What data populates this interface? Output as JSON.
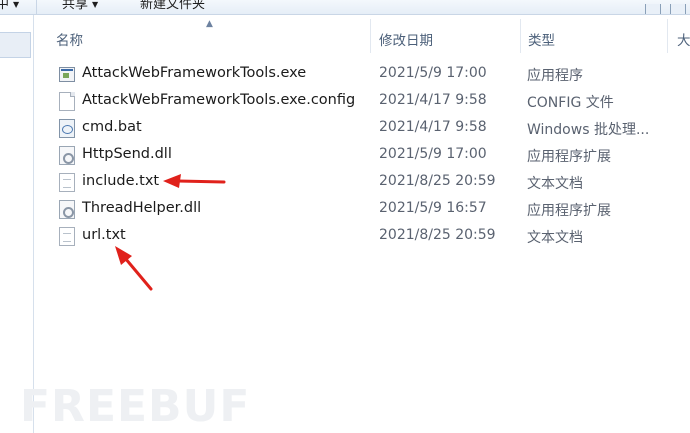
{
  "toolbar": {
    "item_left": "中",
    "share_label": "共享",
    "new_folder_label": "新建文件夹"
  },
  "columns": {
    "name": "名称",
    "modified": "修改日期",
    "type": "类型",
    "size": "大"
  },
  "files": [
    {
      "name": "AttackWebFrameworkTools.exe",
      "date": "2021/5/9 17:00",
      "type": "应用程序",
      "icon": "exe-icon"
    },
    {
      "name": "AttackWebFrameworkTools.exe.config",
      "date": "2021/4/17 9:58",
      "type": "CONFIG 文件",
      "icon": "document-icon"
    },
    {
      "name": "cmd.bat",
      "date": "2021/4/17 9:58",
      "type": "Windows 批处理...",
      "icon": "batch-icon"
    },
    {
      "name": "HttpSend.dll",
      "date": "2021/5/9 17:00",
      "type": "应用程序扩展",
      "icon": "dll-icon"
    },
    {
      "name": "include.txt",
      "date": "2021/8/25 20:59",
      "type": "文本文档",
      "icon": "text-file-icon"
    },
    {
      "name": "ThreadHelper.dll",
      "date": "2021/5/9 16:57",
      "type": "应用程序扩展",
      "icon": "dll-icon"
    },
    {
      "name": "url.txt",
      "date": "2021/8/25 20:59",
      "type": "文本文档",
      "icon": "text-file-icon"
    }
  ],
  "watermark": "FREEBUF",
  "colors": {
    "annotation_arrow": "#e0211b",
    "header_text": "#4c607a"
  }
}
